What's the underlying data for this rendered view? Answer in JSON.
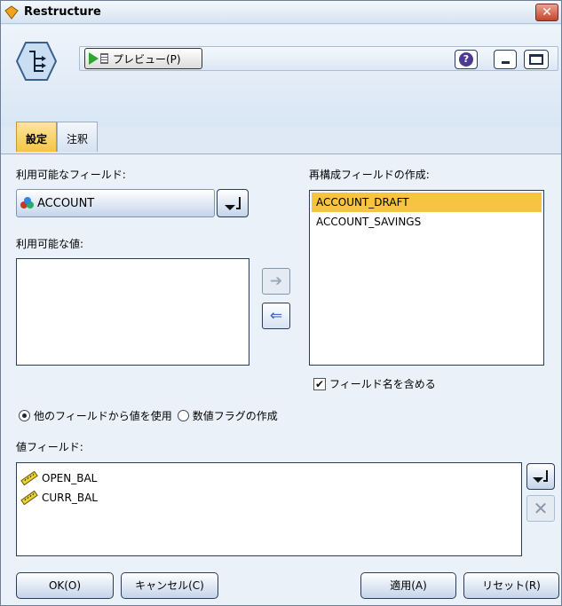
{
  "window": {
    "title": "Restructure",
    "close_glyph": "✕"
  },
  "toolbar": {
    "preview_label": "プレビュー(P)",
    "help_glyph": "?"
  },
  "tabs": [
    {
      "label": "設定",
      "active": true
    },
    {
      "label": "注釈",
      "active": false
    }
  ],
  "settings": {
    "available_fields_label": "利用可能なフィールド:",
    "selected_field": "ACCOUNT",
    "available_values_label": "利用可能な値:",
    "restructure_label": "再構成フィールドの作成:",
    "restructure_items": [
      "ACCOUNT_DRAFT",
      "ACCOUNT_SAVINGS"
    ],
    "include_field_name_label": "フィールド名を含める",
    "include_field_name_checked": true,
    "radio_use_values_label": "他のフィールドから値を使用",
    "radio_flag_label": "数値フラグの作成",
    "value_fields_label": "値フィールド:",
    "value_fields": [
      "OPEN_BAL",
      "CURR_BAL"
    ]
  },
  "buttons": {
    "ok": "OK(O)",
    "cancel": "キャンセル(C)",
    "apply": "適用(A)",
    "reset": "リセット(R)"
  },
  "glyphs": {
    "arrow_right": "➔",
    "arrow_left": "⇐",
    "delete": "✕",
    "check": "✔"
  },
  "colors": {
    "accent": "#f5c542",
    "title_bg": "#d6e3f1",
    "panel_bg": "#eaf1f9"
  }
}
